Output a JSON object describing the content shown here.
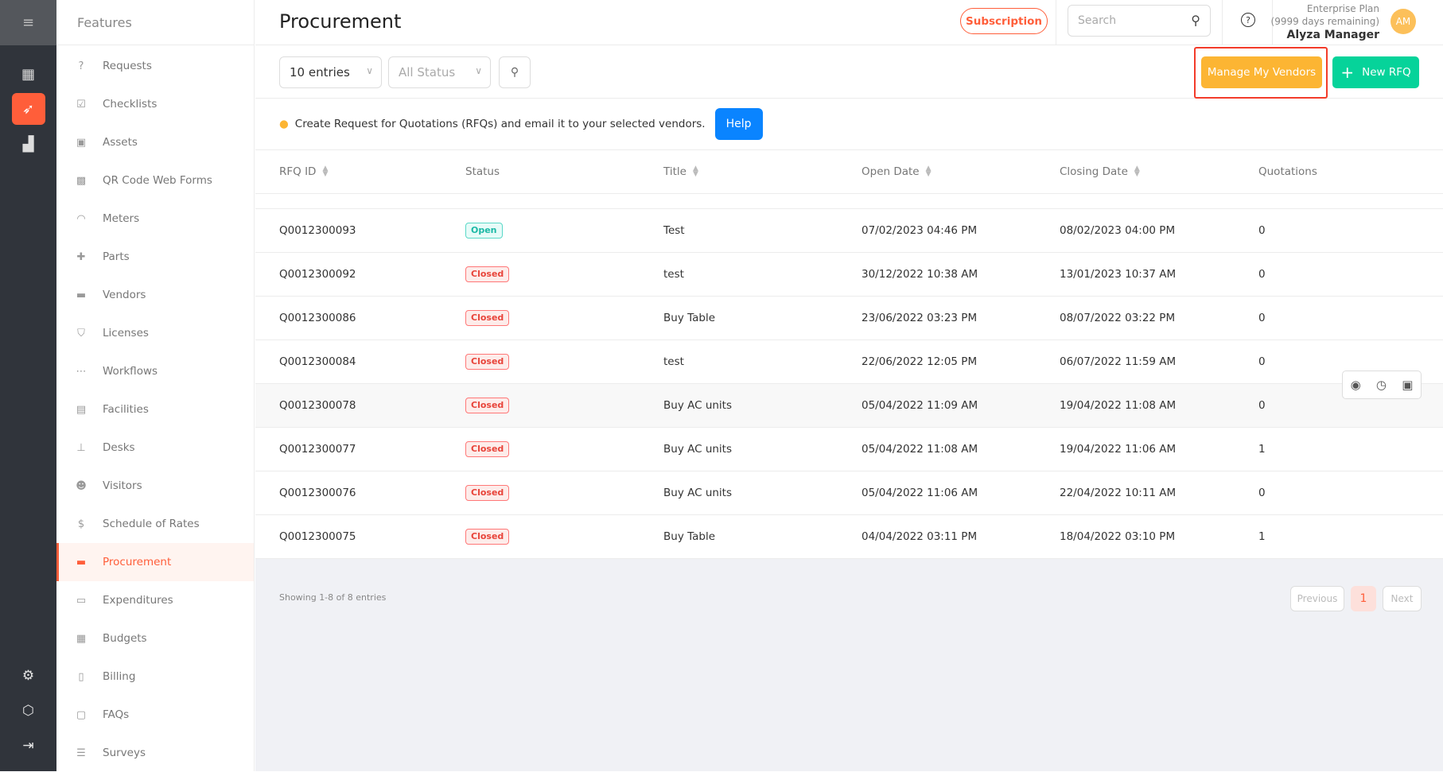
{
  "rail": {
    "items": [
      {
        "icon": "dashboard-icon",
        "glyph": "▦"
      },
      {
        "icon": "procurement-rocket-icon",
        "glyph": "➶",
        "active": true
      },
      {
        "icon": "reports-icon",
        "glyph": "▟"
      }
    ],
    "bottom": [
      {
        "icon": "settings-icon",
        "glyph": "⚙"
      },
      {
        "icon": "package-icon",
        "glyph": "⬡"
      },
      {
        "icon": "logout-icon",
        "glyph": "⇥"
      }
    ]
  },
  "features": {
    "title": "Features",
    "items": [
      {
        "label": "Requests",
        "glyph": "?"
      },
      {
        "label": "Checklists",
        "glyph": "☑"
      },
      {
        "label": "Assets",
        "glyph": "▣"
      },
      {
        "label": "QR Code Web Forms",
        "glyph": "▩"
      },
      {
        "label": "Meters",
        "glyph": "◠"
      },
      {
        "label": "Parts",
        "glyph": "✚"
      },
      {
        "label": "Vendors",
        "glyph": "▬"
      },
      {
        "label": "Licenses",
        "glyph": "⛉"
      },
      {
        "label": "Workflows",
        "glyph": "⋯"
      },
      {
        "label": "Facilities",
        "glyph": "▤"
      },
      {
        "label": "Desks",
        "glyph": "⊥"
      },
      {
        "label": "Visitors",
        "glyph": "☻"
      },
      {
        "label": "Schedule of Rates",
        "glyph": "$"
      },
      {
        "label": "Procurement",
        "glyph": "▬",
        "active": true
      },
      {
        "label": "Expenditures",
        "glyph": "▭"
      },
      {
        "label": "Budgets",
        "glyph": "▦"
      },
      {
        "label": "Billing",
        "glyph": "▯"
      },
      {
        "label": "FAQs",
        "glyph": "▢"
      },
      {
        "label": "Surveys",
        "glyph": "☰"
      }
    ]
  },
  "header": {
    "title": "Procurement",
    "subscription": "Subscription",
    "search_placeholder": "Search",
    "plan": "Enterprise Plan",
    "plan_remaining": "(9999 days remaining)",
    "user": "Alyza Manager",
    "avatar": "AM"
  },
  "toolbar": {
    "entries": "10 entries",
    "status": "All Status",
    "manage_vendors": "Manage My Vendors",
    "new_rfq": "New RFQ"
  },
  "info": {
    "text": "Create Request for Quotations (RFQs) and email it to your selected vendors.",
    "help": "Help"
  },
  "table": {
    "columns": [
      {
        "label": "RFQ ID",
        "sortable": true
      },
      {
        "label": "Status",
        "sortable": false
      },
      {
        "label": "Title",
        "sortable": true
      },
      {
        "label": "Open Date",
        "sortable": true
      },
      {
        "label": "Closing Date",
        "sortable": true
      },
      {
        "label": "Quotations",
        "sortable": false
      }
    ],
    "rows": [
      [
        "Q0012300093",
        "Open",
        "Test",
        "07/02/2023 04:46 PM",
        "08/02/2023 04:00 PM",
        "0"
      ],
      [
        "Q0012300092",
        "Closed",
        "test",
        "30/12/2022 10:38 AM",
        "13/01/2023 10:37 AM",
        "0"
      ],
      [
        "Q0012300086",
        "Closed",
        "Buy Table",
        "23/06/2022 03:23 PM",
        "08/07/2022 03:22 PM",
        "0"
      ],
      [
        "Q0012300084",
        "Closed",
        "test",
        "22/06/2022 12:05 PM",
        "06/07/2022 11:59 AM",
        "0"
      ],
      [
        "Q0012300078",
        "Closed",
        "Buy AC units",
        "05/04/2022 11:09 AM",
        "19/04/2022 11:08 AM",
        "0"
      ],
      [
        "Q0012300077",
        "Closed",
        "Buy AC units",
        "05/04/2022 11:08 AM",
        "19/04/2022 11:06 AM",
        "1"
      ],
      [
        "Q0012300076",
        "Closed",
        "Buy AC units",
        "05/04/2022 11:06 AM",
        "22/04/2022 10:11 AM",
        "0"
      ],
      [
        "Q0012300075",
        "Closed",
        "Buy Table",
        "04/04/2022 03:11 PM",
        "18/04/2022 03:10 PM",
        "1"
      ]
    ],
    "hover_row": 4,
    "row_actions": [
      {
        "icon": "view-eye-icon",
        "glyph": "◉"
      },
      {
        "icon": "history-icon",
        "glyph": "◷"
      },
      {
        "icon": "wallet-icon",
        "glyph": "▣"
      }
    ]
  },
  "footer": {
    "showing": "Showing 1-8 of 8 entries",
    "previous": "Previous",
    "current_page": "1",
    "next": "Next"
  },
  "colors": {
    "accent": "#ff5e3a",
    "vendors": "#fcb533",
    "new_rfq": "#06d39a",
    "help": "#0a84ff"
  }
}
